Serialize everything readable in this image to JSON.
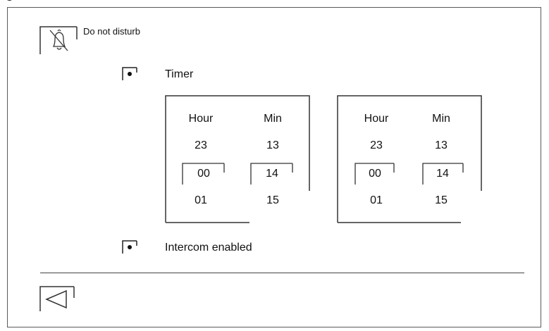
{
  "screen": {
    "title": "Do not disturb"
  },
  "options": {
    "timer_label": "Timer",
    "intercom_label": "Intercom enabled"
  },
  "timers": [
    {
      "hour_header": "Hour",
      "min_header": "Min",
      "hour_prev": "23",
      "hour_selected": "00",
      "hour_next": "01",
      "min_prev": "13",
      "min_selected": "14",
      "min_next": "15"
    },
    {
      "hour_header": "Hour",
      "min_header": "Min",
      "hour_prev": "23",
      "hour_selected": "00",
      "hour_next": "01",
      "min_prev": "13",
      "min_selected": "14",
      "min_next": "15"
    }
  ],
  "icons": {
    "mute": "bell-off-icon",
    "back": "back-arrow-icon",
    "radio": "radio-selected-icon"
  }
}
